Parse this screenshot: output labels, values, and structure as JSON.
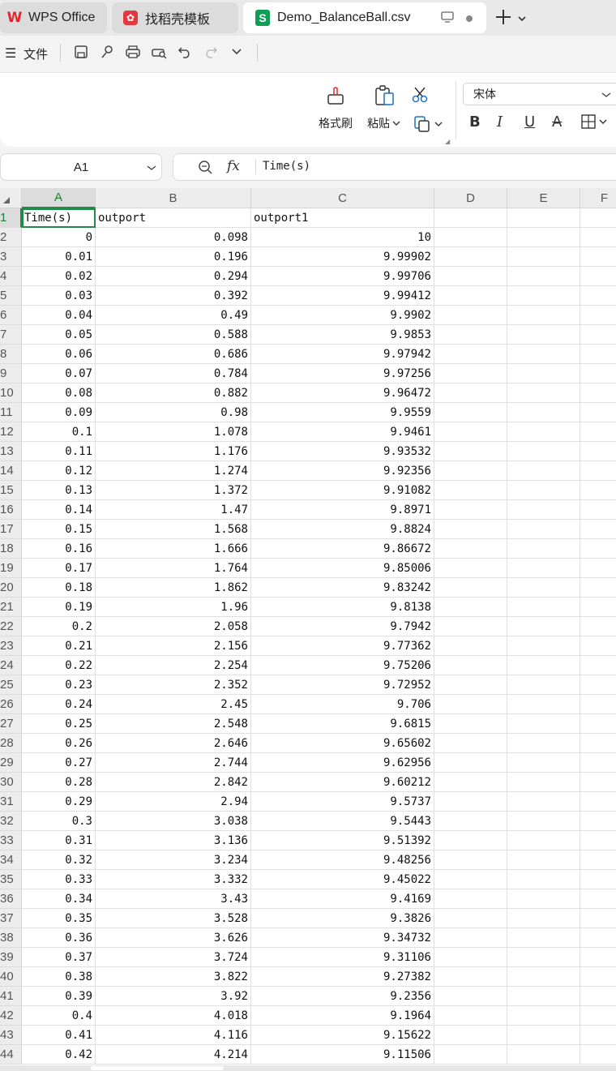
{
  "tabs": [
    {
      "label": "WPS Office",
      "icon": "wps-logo-icon"
    },
    {
      "label": "找稻壳模板",
      "icon": "template-logo-icon"
    },
    {
      "label": "Demo_BalanceBall.csv",
      "icon": "spreadsheet-logo-icon"
    }
  ],
  "menu": {
    "file_label": "文件"
  },
  "ribbon": {
    "format_painter": "格式刷",
    "paste": "粘贴",
    "font_name": "宋体"
  },
  "formula_bar": {
    "name_box": "A1",
    "formula": "Time(s)"
  },
  "sheet": {
    "columns": [
      "A",
      "B",
      "C",
      "D",
      "E",
      "F"
    ],
    "header_row": [
      "Time(s)",
      "outport",
      "outport1"
    ],
    "rows": [
      [
        "0",
        "0.098",
        "10"
      ],
      [
        "0.01",
        "0.196",
        "9.99902"
      ],
      [
        "0.02",
        "0.294",
        "9.99706"
      ],
      [
        "0.03",
        "0.392",
        "9.99412"
      ],
      [
        "0.04",
        "0.49",
        "9.9902"
      ],
      [
        "0.05",
        "0.588",
        "9.9853"
      ],
      [
        "0.06",
        "0.686",
        "9.97942"
      ],
      [
        "0.07",
        "0.784",
        "9.97256"
      ],
      [
        "0.08",
        "0.882",
        "9.96472"
      ],
      [
        "0.09",
        "0.98",
        "9.9559"
      ],
      [
        "0.1",
        "1.078",
        "9.9461"
      ],
      [
        "0.11",
        "1.176",
        "9.93532"
      ],
      [
        "0.12",
        "1.274",
        "9.92356"
      ],
      [
        "0.13",
        "1.372",
        "9.91082"
      ],
      [
        "0.14",
        "1.47",
        "9.8971"
      ],
      [
        "0.15",
        "1.568",
        "9.8824"
      ],
      [
        "0.16",
        "1.666",
        "9.86672"
      ],
      [
        "0.17",
        "1.764",
        "9.85006"
      ],
      [
        "0.18",
        "1.862",
        "9.83242"
      ],
      [
        "0.19",
        "1.96",
        "9.8138"
      ],
      [
        "0.2",
        "2.058",
        "9.7942"
      ],
      [
        "0.21",
        "2.156",
        "9.77362"
      ],
      [
        "0.22",
        "2.254",
        "9.75206"
      ],
      [
        "0.23",
        "2.352",
        "9.72952"
      ],
      [
        "0.24",
        "2.45",
        "9.706"
      ],
      [
        "0.25",
        "2.548",
        "9.6815"
      ],
      [
        "0.26",
        "2.646",
        "9.65602"
      ],
      [
        "0.27",
        "2.744",
        "9.62956"
      ],
      [
        "0.28",
        "2.842",
        "9.60212"
      ],
      [
        "0.29",
        "2.94",
        "9.5737"
      ],
      [
        "0.3",
        "3.038",
        "9.5443"
      ],
      [
        "0.31",
        "3.136",
        "9.51392"
      ],
      [
        "0.32",
        "3.234",
        "9.48256"
      ],
      [
        "0.33",
        "3.332",
        "9.45022"
      ],
      [
        "0.34",
        "3.43",
        "9.4169"
      ],
      [
        "0.35",
        "3.528",
        "9.3826"
      ],
      [
        "0.36",
        "3.626",
        "9.34732"
      ],
      [
        "0.37",
        "3.724",
        "9.31106"
      ],
      [
        "0.38",
        "3.822",
        "9.27382"
      ],
      [
        "0.39",
        "3.92",
        "9.2356"
      ],
      [
        "0.4",
        "4.018",
        "9.1964"
      ],
      [
        "0.41",
        "4.116",
        "9.15622"
      ],
      [
        "0.42",
        "4.214",
        "9.11506"
      ]
    ]
  },
  "colors": {
    "accent": "#1e8c45",
    "wps_red": "#e3262c",
    "sheet_green": "#0f9d58"
  }
}
